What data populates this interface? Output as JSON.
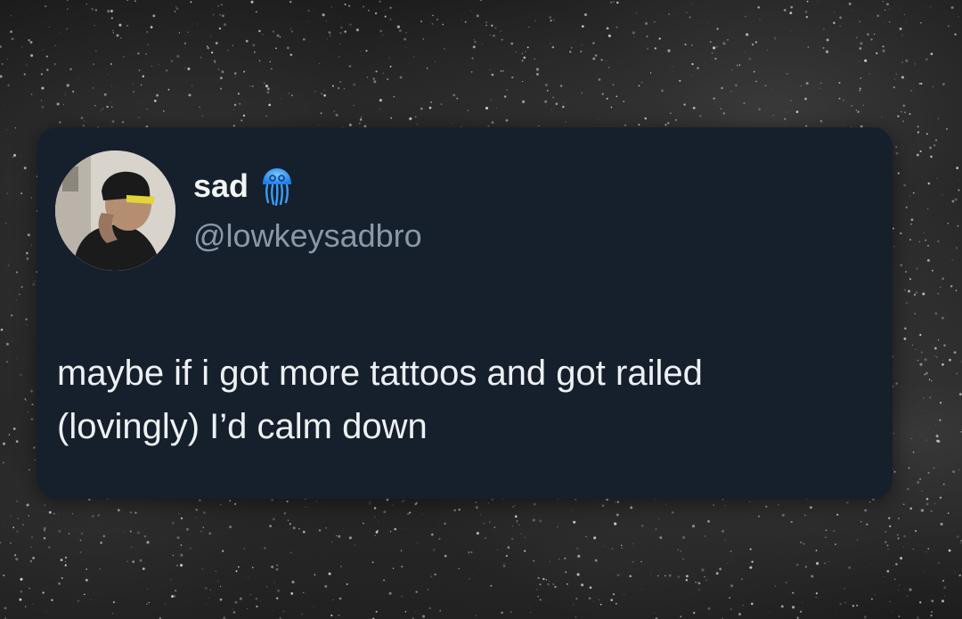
{
  "tweet": {
    "author_name": "sad",
    "author_handle": "@lowkeysadbro",
    "badge_icon": "jellyfish-emoji-icon",
    "text_line_1": "maybe if i got more tattoos and got railed",
    "text_line_2": "(lovingly) I’d calm down"
  },
  "colors": {
    "card_background": "#16202c",
    "name_color": "#f2f4f6",
    "handle_color": "#8a98a8",
    "text_color": "#eef1f4",
    "badge_color": "#1e8fff"
  }
}
